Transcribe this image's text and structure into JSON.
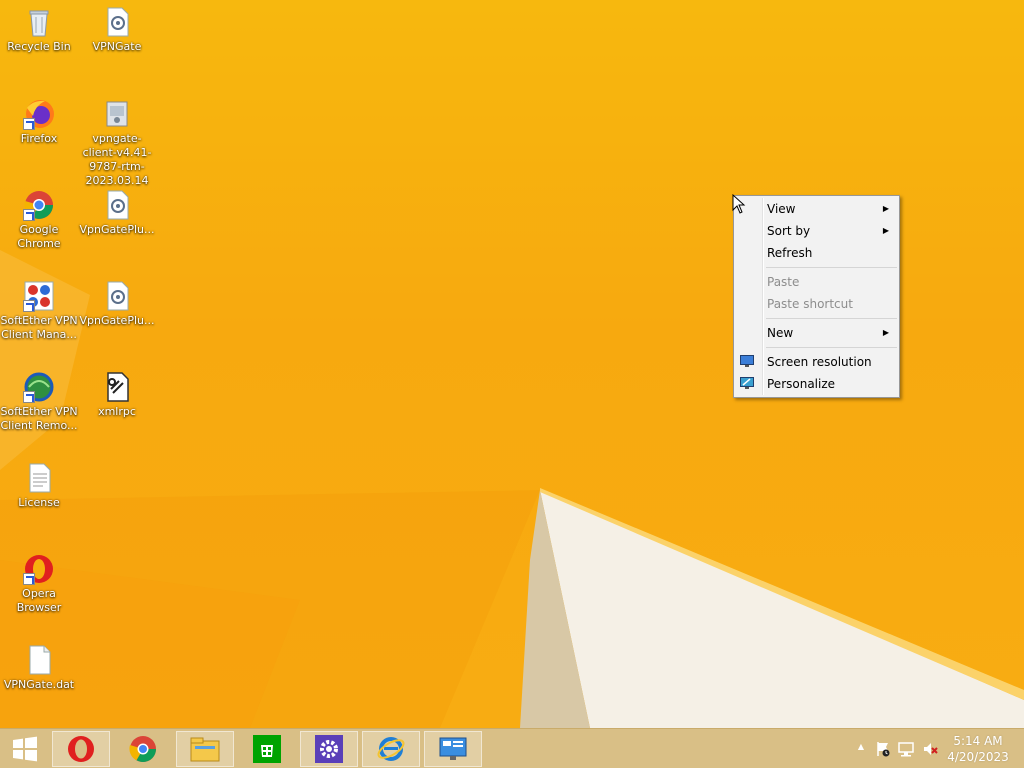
{
  "desktop_icons": [
    {
      "label": "Recycle Bin",
      "icon": "recycle-bin-icon"
    },
    {
      "label": "VPNGate",
      "icon": "config-file-icon"
    },
    {
      "label": "Firefox",
      "icon": "firefox-icon"
    },
    {
      "label": "vpngate-client-v4.41-9787-rtm-2023.03.14",
      "icon": "installer-icon"
    },
    {
      "label": "Google Chrome",
      "icon": "chrome-icon"
    },
    {
      "label": "VpnGatePlu...",
      "icon": "config-file-icon"
    },
    {
      "label": "SoftEther VPN Client Mana...",
      "icon": "softether-manager-icon"
    },
    {
      "label": "VpnGatePlu...",
      "icon": "config-file-icon"
    },
    {
      "label": "SoftEther VPN Client Remo...",
      "icon": "softether-remote-icon"
    },
    {
      "label": "xmlrpc",
      "icon": "xmlrpc-file-icon"
    },
    {
      "label": "License",
      "icon": "text-file-icon"
    },
    {
      "label": "Opera Browser",
      "icon": "opera-icon"
    },
    {
      "label": "VPNGate.dat",
      "icon": "blank-file-icon"
    }
  ],
  "labels": {
    "recycle": "Recycle Bin",
    "vpngate": "VPNGate",
    "firefox": "Firefox",
    "installer": "vpngate-client-v4.41-9787-rtm-2023.03.14",
    "chrome": "Google Chrome",
    "plugin1": "VpnGatePlu...",
    "softether_mgr": "SoftEther VPN Client Mana...",
    "plugin2": "VpnGatePlu...",
    "softether_remote": "SoftEther VPN Client Remo...",
    "xmlrpc": "xmlrpc",
    "license": "License",
    "opera": "Opera Browser",
    "dat": "VPNGate.dat"
  },
  "context_menu": {
    "view": "View",
    "sort_by": "Sort by",
    "refresh": "Refresh",
    "paste": "Paste",
    "paste_shortcut": "Paste shortcut",
    "new": "New",
    "screen_resolution": "Screen resolution",
    "personalize": "Personalize",
    "submenu_arrow": "▶"
  },
  "taskbar": {
    "start_icon": "windows-logo-icon",
    "pinned": [
      "opera-icon",
      "chrome-icon",
      "file-explorer-icon",
      "store-icon",
      "settings-icon",
      "internet-explorer-icon",
      "control-panel-icon"
    ]
  },
  "tray": {
    "show_hidden": "▲",
    "time": "5:14 AM",
    "date": "4/20/2023"
  },
  "colors": {
    "wallpaper": "#f7b00e",
    "taskbar": "#d9bf86",
    "menu_bg": "#f2f2f2"
  }
}
